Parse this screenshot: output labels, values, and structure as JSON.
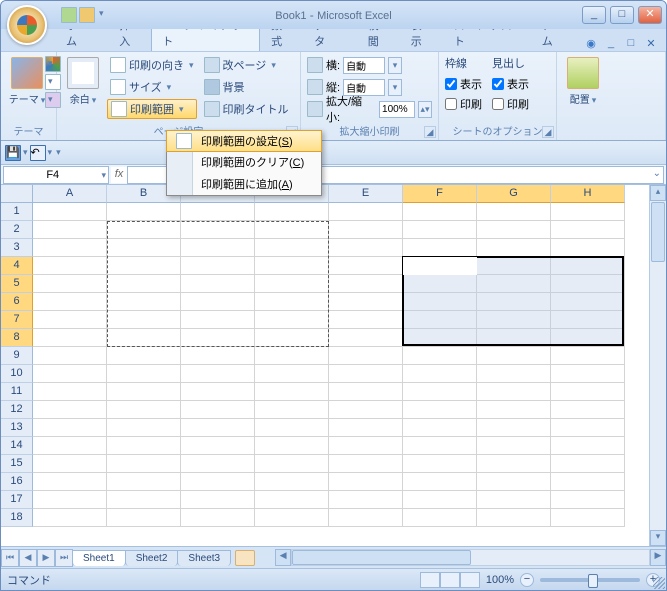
{
  "title_doc": "Book1",
  "title_app": "Microsoft Excel",
  "tabs": [
    "ホーム",
    "挿入",
    "ページ レイアウト",
    "数式",
    "データ",
    "校閲",
    "表示",
    "ロード テスト",
    "チーム"
  ],
  "active_tab": 2,
  "ribbon": {
    "group_themes": {
      "label": "テーマ",
      "btn_themes": "テーマ"
    },
    "group_pagesetup": {
      "label": "ページ設定",
      "btn_margin": "余白",
      "btn_orient": "印刷の向き",
      "btn_size": "サイズ",
      "btn_printarea": "印刷範囲",
      "btn_breaks": "改ページ",
      "btn_background": "背景",
      "btn_titles": "印刷タイトル"
    },
    "group_scale": {
      "label": "拡大縮小印刷",
      "lbl_width": "横:",
      "lbl_height": "縦:",
      "lbl_scale": "拡大/縮小:",
      "val_width": "自動",
      "val_height": "自動",
      "val_scale": "100%"
    },
    "group_gridlines": {
      "head": "枠線",
      "chk_view": "表示",
      "chk_print": "印刷"
    },
    "group_headings": {
      "head": "見出し",
      "chk_view": "表示",
      "chk_print": "印刷"
    },
    "group_sheetopts": {
      "label": "シートのオプション"
    },
    "group_arrange": {
      "btn": "配置"
    }
  },
  "dropdown": {
    "set": "印刷範囲の設定",
    "set_key": "S",
    "clear": "印刷範囲のクリア",
    "clear_key": "C",
    "add": "印刷範囲に追加",
    "add_key": "A"
  },
  "name_box": "F4",
  "columns": [
    "A",
    "B",
    "C",
    "D",
    "E",
    "F",
    "G",
    "H"
  ],
  "rows": [
    "1",
    "2",
    "3",
    "4",
    "5",
    "6",
    "7",
    "8",
    "9",
    "10",
    "11",
    "12",
    "13",
    "14",
    "15",
    "16",
    "17",
    "18"
  ],
  "selected_cols": [
    5,
    6,
    7
  ],
  "selected_rows": [
    3,
    4,
    5,
    6,
    7
  ],
  "dashed": {
    "c1": 1,
    "r1": 1,
    "c2": 3,
    "r2": 7
  },
  "solid": {
    "c1": 5,
    "r1": 3,
    "c2": 7,
    "r2": 7
  },
  "sheets": [
    "Sheet1",
    "Sheet2",
    "Sheet3"
  ],
  "active_sheet": 0,
  "status_left": "コマンド",
  "zoom": "100%"
}
